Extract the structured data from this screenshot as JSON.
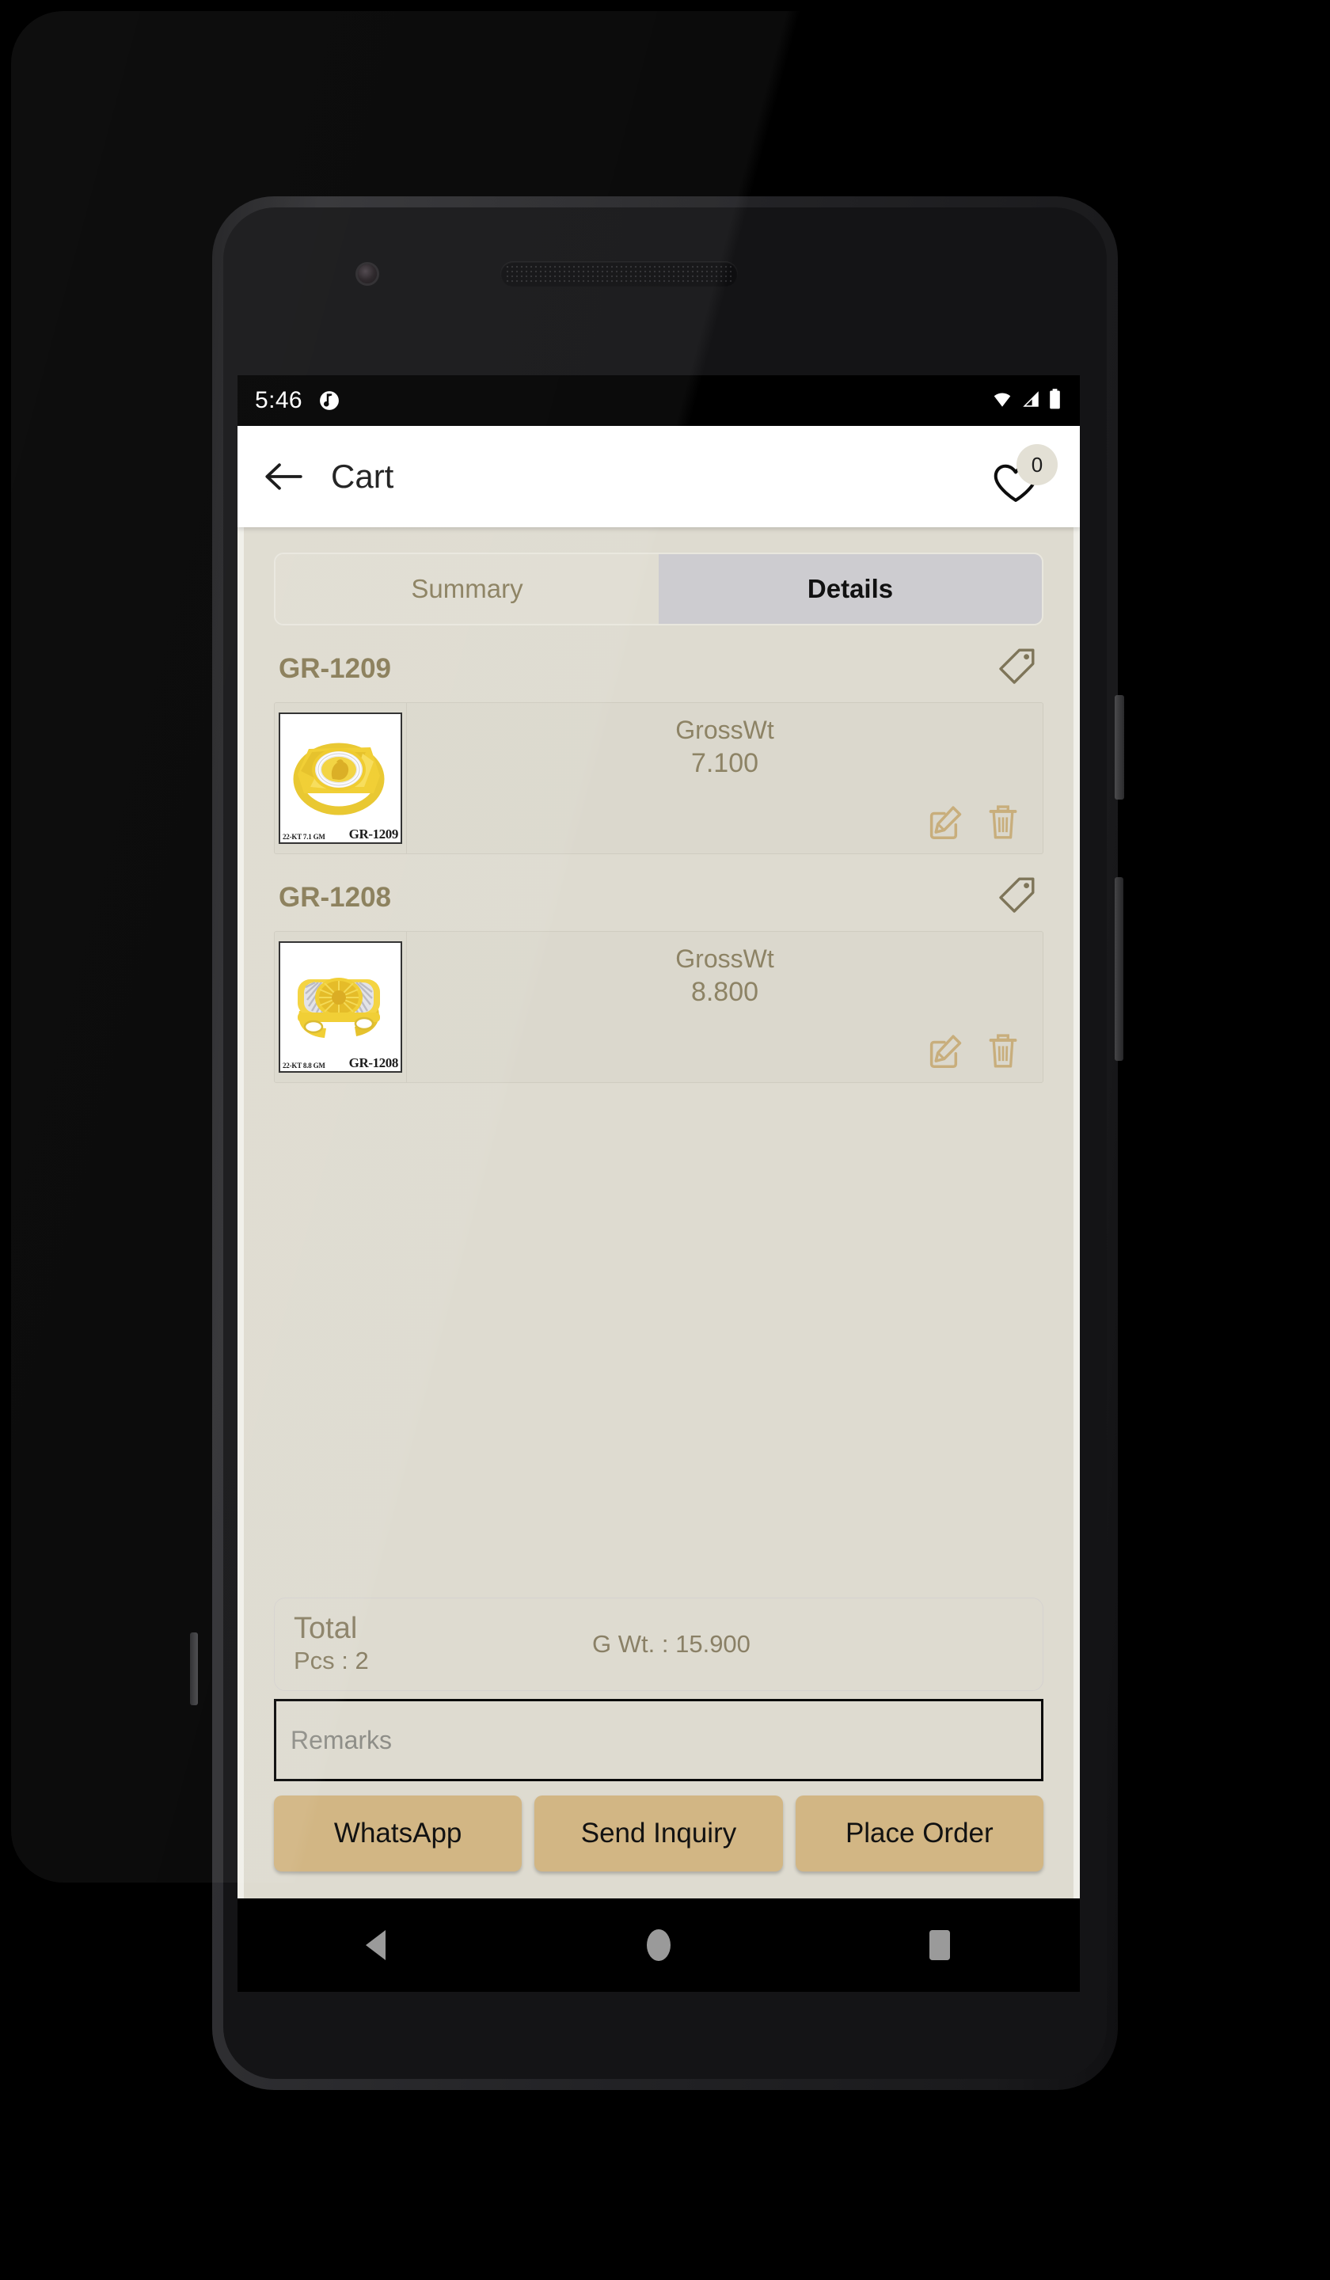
{
  "status_bar": {
    "time": "5:46",
    "notification_icon": "app-notification-icon",
    "wifi_icon": "wifi-icon",
    "signal_icon": "cellular-signal-icon",
    "battery_icon": "battery-full-icon"
  },
  "app_bar": {
    "back_icon": "back-arrow-icon",
    "title": "Cart",
    "wishlist_icon": "heart-icon",
    "wishlist_count": "0"
  },
  "tabs": [
    {
      "label": "Summary",
      "active": false
    },
    {
      "label": "Details",
      "active": true
    }
  ],
  "products": [
    {
      "code": "GR-1209",
      "tag_icon": "price-tag-icon",
      "image_caption_left": "22-KT  7.1 GM",
      "image_caption_right": "GR-1209",
      "weight_label": "GrossWt",
      "weight_value": "7.100",
      "edit_icon": "edit-pencil-icon",
      "delete_icon": "trash-icon"
    },
    {
      "code": "GR-1208",
      "tag_icon": "price-tag-icon",
      "image_caption_left": "22-KT  8.8 GM",
      "image_caption_right": "GR-1208",
      "weight_label": "GrossWt",
      "weight_value": "8.800",
      "edit_icon": "edit-pencil-icon",
      "delete_icon": "trash-icon"
    }
  ],
  "total": {
    "label": "Total",
    "pcs": "Pcs : 2",
    "gross_weight": "G Wt. : 15.900"
  },
  "remarks": {
    "placeholder": "Remarks",
    "value": ""
  },
  "actions": [
    {
      "label": "WhatsApp"
    },
    {
      "label": "Send Inquiry"
    },
    {
      "label": "Place Order"
    }
  ],
  "navigation_bar": {
    "back_icon": "nav-back-triangle-icon",
    "home_icon": "nav-home-circle-icon",
    "recents_icon": "nav-recents-square-icon"
  },
  "colors": {
    "accent_gold": "#d2b684",
    "olive_text": "#8a8066",
    "content_bg": "#dedbd0",
    "card_bg": "#dbd8cd",
    "active_tab_bg": "#cdccd0"
  }
}
